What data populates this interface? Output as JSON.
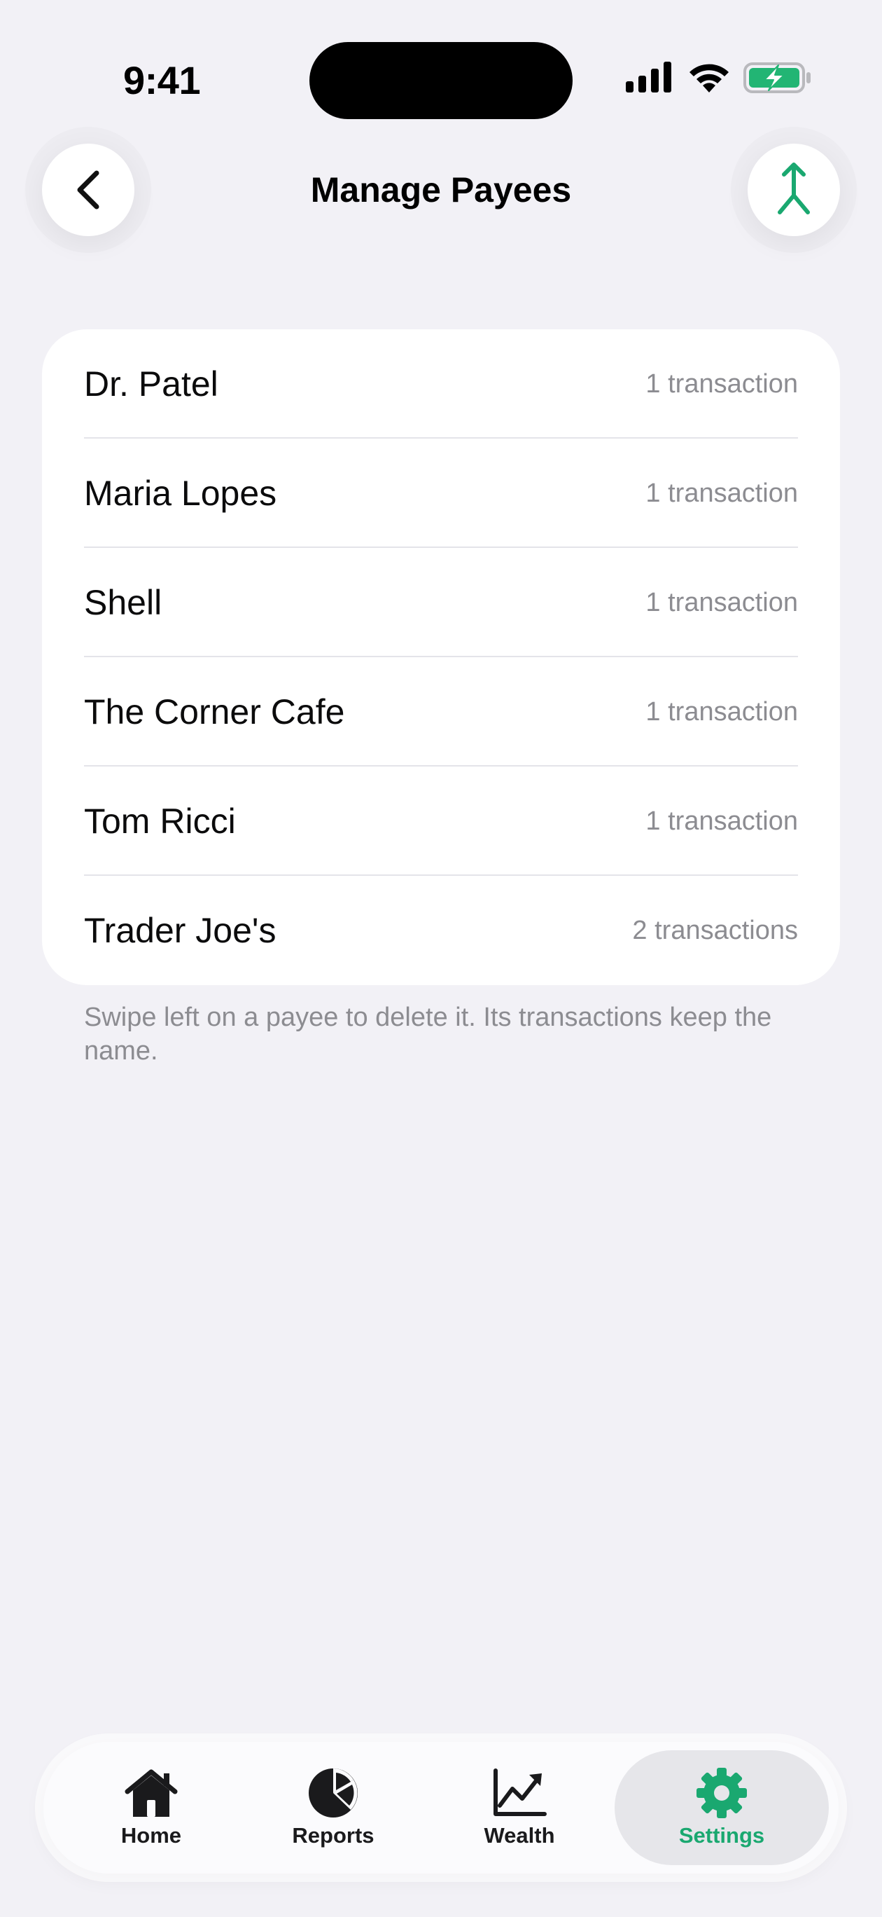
{
  "status_bar": {
    "time": "9:41"
  },
  "header": {
    "title": "Manage Payees",
    "back_icon": "chevron-left-icon",
    "merge_icon": "merge-icon"
  },
  "payees": [
    {
      "name": "Dr. Patel",
      "count": "1 transaction"
    },
    {
      "name": "Maria Lopes",
      "count": "1 transaction"
    },
    {
      "name": "Shell",
      "count": "1 transaction"
    },
    {
      "name": "The Corner Cafe",
      "count": "1 transaction"
    },
    {
      "name": "Tom Ricci",
      "count": "1 transaction"
    },
    {
      "name": "Trader Joe's",
      "count": "2 transactions"
    }
  ],
  "footnote": "Swipe left on a payee to delete it. Its transactions keep the name.",
  "tab_bar": {
    "tabs": [
      {
        "label": "Home",
        "icon": "home-icon"
      },
      {
        "label": "Reports",
        "icon": "pie-chart-icon"
      },
      {
        "label": "Wealth",
        "icon": "line-chart-icon"
      },
      {
        "label": "Settings",
        "icon": "gear-icon"
      }
    ],
    "selected": "Settings"
  },
  "colors": {
    "accent": "#1aa870",
    "background": "#f2f1f6",
    "card": "#ffffff",
    "secondary_text": "#8c8c91"
  }
}
